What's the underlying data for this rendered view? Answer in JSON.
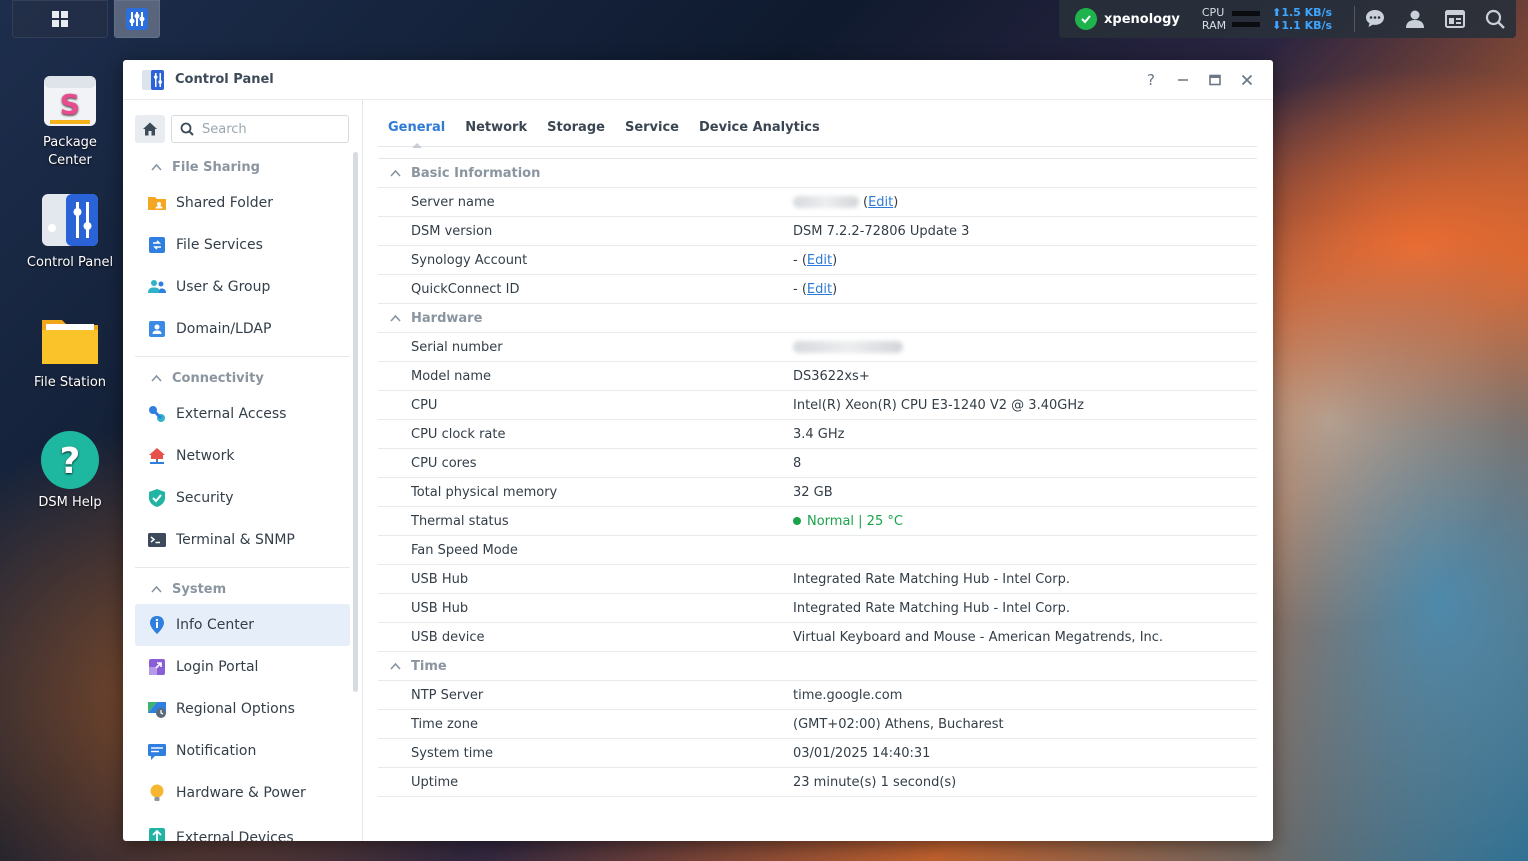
{
  "taskbar": {
    "system_name": "xpenology",
    "cpu_label": "CPU",
    "ram_label": "RAM",
    "upload_speed": "1.5 KB/s",
    "download_speed": "1.1 KB/s"
  },
  "desktop": {
    "icons": [
      {
        "label": "Package Center"
      },
      {
        "label": "Control Panel"
      },
      {
        "label": "File Station"
      },
      {
        "label": "DSM Help"
      }
    ]
  },
  "window": {
    "title": "Control Panel",
    "help_label": "?"
  },
  "sidebar": {
    "search_placeholder": "Search",
    "categories": [
      {
        "label": "File Sharing",
        "items": [
          "Shared Folder",
          "File Services",
          "User & Group",
          "Domain/LDAP"
        ]
      },
      {
        "label": "Connectivity",
        "items": [
          "External Access",
          "Network",
          "Security",
          "Terminal & SNMP"
        ]
      },
      {
        "label": "System",
        "items": [
          "Info Center",
          "Login Portal",
          "Regional Options",
          "Notification",
          "Hardware & Power",
          "External Devices"
        ]
      }
    ],
    "active_item": "Info Center"
  },
  "tabs": [
    "General",
    "Network",
    "Storage",
    "Service",
    "Device Analytics"
  ],
  "active_tab": "General",
  "sections": {
    "basic": {
      "title": "Basic Information",
      "server_name_label": "Server name",
      "edit": "Edit",
      "dsm_version_label": "DSM version",
      "dsm_version": "DSM 7.2.2-72806 Update 3",
      "synology_account_label": "Synology Account",
      "synology_account": "-",
      "quickconnect_label": "QuickConnect ID",
      "quickconnect": "-"
    },
    "hardware": {
      "title": "Hardware",
      "serial_label": "Serial number",
      "model_label": "Model name",
      "model": "DS3622xs+",
      "cpu_label": "CPU",
      "cpu": "Intel(R) Xeon(R) CPU E3-1240 V2 @ 3.40GHz",
      "clock_label": "CPU clock rate",
      "clock": "3.4 GHz",
      "cores_label": "CPU cores",
      "cores": "8",
      "memory_label": "Total physical memory",
      "memory": "32 GB",
      "thermal_label": "Thermal status",
      "thermal": "Normal | 25 °C",
      "fan_label": "Fan Speed Mode",
      "fan": "",
      "usb_hub1_label": "USB Hub",
      "usb_hub1": "Integrated Rate Matching Hub - Intel Corp.",
      "usb_hub2_label": "USB Hub",
      "usb_hub2": "Integrated Rate Matching Hub - Intel Corp.",
      "usb_device_label": "USB device",
      "usb_device": "Virtual Keyboard and Mouse - American Megatrends, Inc."
    },
    "time": {
      "title": "Time",
      "ntp_label": "NTP Server",
      "ntp": "time.google.com",
      "tz_label": "Time zone",
      "tz": "(GMT+02:00) Athens, Bucharest",
      "systime_label": "System time",
      "systime": "03/01/2025 14:40:31",
      "uptime_label": "Uptime",
      "uptime": "23 minute(s) 1 second(s)"
    }
  },
  "colors": {
    "accent": "#2d7bd6",
    "ok": "#1aa34a"
  }
}
